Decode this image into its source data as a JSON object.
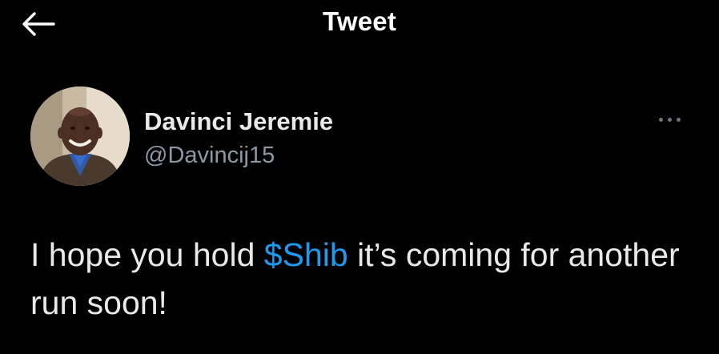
{
  "header": {
    "title": "Tweet",
    "back_icon": "arrow-left-icon"
  },
  "author": {
    "display_name": "Davinci Jeremie",
    "handle": "@Davincij15",
    "avatar_icon": "avatar"
  },
  "more_icon": "more-horizontal-icon",
  "tweet": {
    "text_before": "I hope you hold ",
    "cashtag": "$Shib",
    "text_after": " it’s coming for another run soon!"
  },
  "colors": {
    "background": "#000000",
    "text": "#e7e9ea",
    "secondary_text": "#8b98a5",
    "link": "#1d9bf0"
  }
}
